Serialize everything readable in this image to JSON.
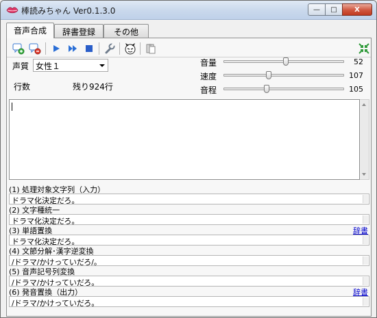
{
  "window": {
    "title": "棒読みちゃん Ver0.1.3.0"
  },
  "title_buttons": {
    "minimize": "—",
    "maximize": "□",
    "close": "X"
  },
  "tabs": [
    {
      "label": "音声合成",
      "active": true
    },
    {
      "label": "辞書登録",
      "active": false
    },
    {
      "label": "その他",
      "active": false
    }
  ],
  "toolbar": {
    "icons": [
      "speech-bubble-add-icon",
      "speech-bubble-remove-icon",
      "play-icon",
      "fast-forward-icon",
      "stop-icon",
      "wrench-icon",
      "face-icon",
      "clipboard-icon",
      "collapse-arrows-icon"
    ]
  },
  "voice": {
    "label": "声質",
    "selected": "女性１"
  },
  "lines": {
    "label": "行数",
    "remaining": "残り924行"
  },
  "sliders": [
    {
      "label": "音量",
      "value": "52",
      "fraction": 0.52
    },
    {
      "label": "速度",
      "value": "107",
      "fraction": 0.37
    },
    {
      "label": "音程",
      "value": "105",
      "fraction": 0.35
    }
  ],
  "input_text": "",
  "stages": [
    {
      "header": "(1) 処理対象文字列（入力）",
      "value": "ドラマ化決定だろ。",
      "dict": ""
    },
    {
      "header": "(2) 文字種統一",
      "value": "ドラマ化決定だろ。",
      "dict": ""
    },
    {
      "header": "(3) 単語置換",
      "value": "ドラマ化決定だろ。",
      "dict": "辞書"
    },
    {
      "header": "(4) 文節分解･漢字逆変換",
      "value": "/ドラマ/かけっていだろ/。",
      "dict": ""
    },
    {
      "header": "(5) 音声記号列変換",
      "value": "/ドラマ/かけっていだろ。",
      "dict": ""
    },
    {
      "header": "(6) 発音置換（出力）",
      "value": "/ドラマ/かけっていだろ。",
      "dict": "辞書"
    }
  ],
  "colors": {
    "accent": "#2b6fd6",
    "stop": "#2a5ec9",
    "link": "#0000cc",
    "lips": "#e23a6a"
  }
}
